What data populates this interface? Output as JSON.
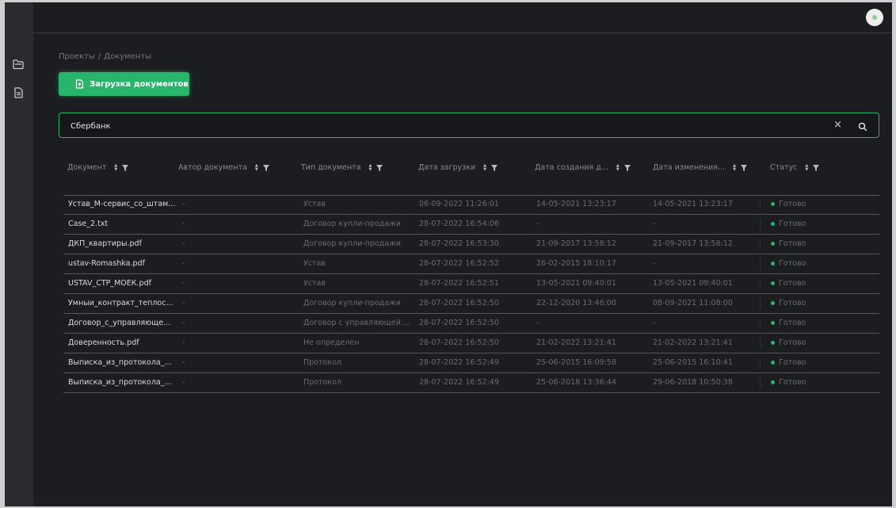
{
  "breadcrumb": {
    "parent": "Проекты",
    "separator": "/",
    "current": "Документы"
  },
  "upload_button": {
    "label": "Загрузка документов"
  },
  "search": {
    "value": "Сбербанк",
    "clear_glyph": "×"
  },
  "table": {
    "columns": [
      "Документ",
      "Автор документа",
      "Тип документа",
      "Дата загрузки",
      "Дата создания д...",
      "Дата изменения...",
      "Статус"
    ],
    "rows": [
      {
        "doc": "Устав_М-сервис_со_штам...",
        "author": "-",
        "type": "Устав",
        "uploaded": "06-09-2022 11:26:01",
        "created": "14-05-2021 13:23:17",
        "modified": "14-05-2021 13:23:17",
        "status": "Готово"
      },
      {
        "doc": "Case_2.txt",
        "author": "-",
        "type": "Договор купли-продажи",
        "uploaded": "28-07-2022 16:54:06",
        "created": "-",
        "modified": "-",
        "status": "Готово"
      },
      {
        "doc": "ДКП_квартиры.pdf",
        "author": "-",
        "type": "Договор купли-продажи",
        "uploaded": "28-07-2022 16:53:30",
        "created": "21-09-2017 13:58:12",
        "modified": "21-09-2017 13:58:12",
        "status": "Готово"
      },
      {
        "doc": "ustav-Romashka.pdf",
        "author": "-",
        "type": "Устав",
        "uploaded": "28-07-2022 16:52:52",
        "created": "26-02-2015 18:10:17",
        "modified": "-",
        "status": "Готово"
      },
      {
        "doc": "USTAV_СТР_МОЕК.pdf",
        "author": "-",
        "type": "Устав",
        "uploaded": "28-07-2022 16:52:51",
        "created": "13-05-2021 09:40:01",
        "modified": "13-05-2021 09:40:01",
        "status": "Готово"
      },
      {
        "doc": "Умныи_контракт_теплос...",
        "author": "-",
        "type": "Договор купли-продажи",
        "uploaded": "28-07-2022 16:52:50",
        "created": "22-12-2020 13:46:00",
        "modified": "08-09-2021 11:08:00",
        "status": "Готово"
      },
      {
        "doc": "Договор_с_управляюще...",
        "author": "-",
        "type": "Договор с управляющей ...",
        "uploaded": "28-07-2022 16:52:50",
        "created": "-",
        "modified": "-",
        "status": "Готово"
      },
      {
        "doc": "Доверенность.pdf",
        "author": "-",
        "type": "Не определен",
        "uploaded": "28-07-2022 16:52:50",
        "created": "21-02-2022 13:21:41",
        "modified": "21-02-2022 13:21:41",
        "status": "Готово"
      },
      {
        "doc": "Выписка_из_протокола_...",
        "author": "-",
        "type": "Протокол",
        "uploaded": "28-07-2022 16:52:49",
        "created": "25-06-2015 16:09:58",
        "modified": "25-06-2015 16:10:41",
        "status": "Готово"
      },
      {
        "doc": "Выписка_из_протокола_...",
        "author": "-",
        "type": "Протокол",
        "uploaded": "28-07-2022 16:52:49",
        "created": "25-06-2018 13:36:44",
        "modified": "29-06-2018 10:50:38",
        "status": "Готово"
      }
    ]
  },
  "icons": {
    "sidebar": [
      "folder-icon",
      "document-icon"
    ],
    "sort": "sort-icon",
    "filter": "filter-icon",
    "search": "search-icon",
    "clear": "clear-icon"
  },
  "colors": {
    "accent": "#27b56b",
    "background": "#1c1d20",
    "sidebar": "#2a2b2f",
    "status_ready": "#27b56b"
  }
}
